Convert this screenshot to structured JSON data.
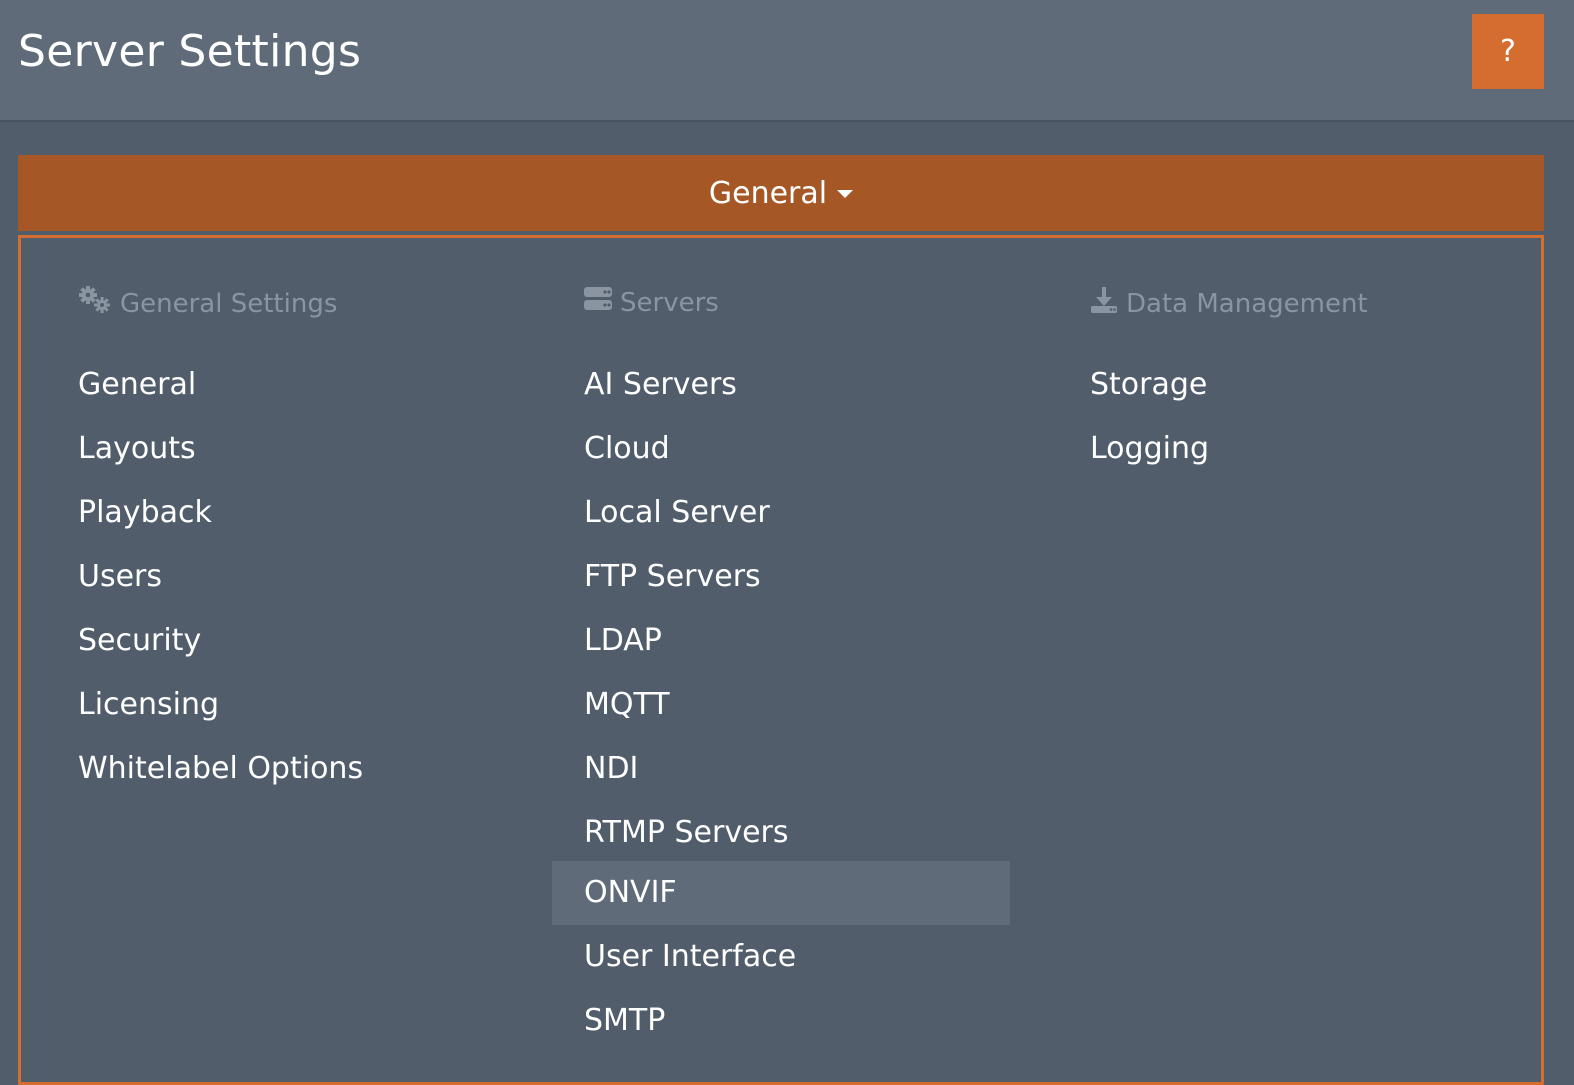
{
  "header": {
    "title": "Server Settings",
    "help_label": "?"
  },
  "dropdown": {
    "label": "General"
  },
  "menu": {
    "columns": [
      {
        "heading": "General Settings",
        "icon": "gears-icon",
        "items": [
          "General",
          "Layouts",
          "Playback",
          "Users",
          "Security",
          "Licensing",
          "Whitelabel Options"
        ]
      },
      {
        "heading": "Servers",
        "icon": "server-icon",
        "items": [
          "AI Servers",
          "Cloud",
          "Local Server",
          "FTP Servers",
          "LDAP",
          "MQTT",
          "NDI",
          "RTMP Servers",
          "ONVIF",
          "User Interface",
          "SMTP"
        ],
        "highlighted": "ONVIF"
      },
      {
        "heading": "Data Management",
        "icon": "download-icon",
        "items": [
          "Storage",
          "Logging"
        ]
      }
    ]
  },
  "colors": {
    "accent": "#d46d2f",
    "dropdown_bg": "#a55726",
    "background": "#515d6b",
    "header_bg": "#5f6b78"
  }
}
